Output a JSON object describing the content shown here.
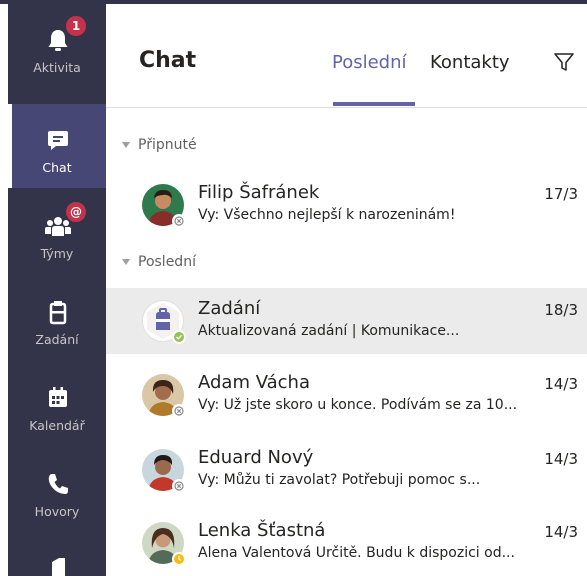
{
  "rail": {
    "items": [
      {
        "label": "Aktivita",
        "badge": "1"
      },
      {
        "label": "Chat"
      },
      {
        "label": "Týmy",
        "badge": "@"
      },
      {
        "label": "Zadání"
      },
      {
        "label": "Kalendář"
      },
      {
        "label": "Hovory"
      }
    ]
  },
  "header": {
    "title": "Chat",
    "tabs": [
      {
        "label": "Poslední"
      },
      {
        "label": "Kontakty"
      }
    ]
  },
  "sections": {
    "pinned": "Připnuté",
    "recent": "Poslední"
  },
  "chats": [
    {
      "name": "Filip Šafránek",
      "date": "17/3",
      "preview": "Vy: Všechno nejlepší k narozeninám!",
      "status": "offline"
    },
    {
      "name": "Zadání",
      "date": "18/3",
      "preview": "Aktualizovaná zadání | Komunikace...",
      "status": "available"
    },
    {
      "name": "Adam Vácha",
      "date": "14/3",
      "preview": "Vy: Už jste skoro u konce. Podívám se za 10...",
      "status": "offline"
    },
    {
      "name": "Eduard Nový",
      "date": "14/3",
      "preview": "Vy: Můžu ti zavolat? Potřebuji pomoc s...",
      "status": "offline"
    },
    {
      "name": "Lenka Šťastná",
      "date": "14/3",
      "preview": "Alena Valentová Určitě. Budu k dispozici od...",
      "status": "away"
    }
  ],
  "colors": {
    "rail_bg": "#33344a",
    "rail_active": "#464775",
    "accent": "#6264a7",
    "badge": "#c4314b"
  },
  "icons": [
    "bell-icon",
    "chat-icon",
    "teams-icon",
    "assignments-icon",
    "calendar-icon",
    "phone-icon",
    "files-icon",
    "filter-icon"
  ]
}
